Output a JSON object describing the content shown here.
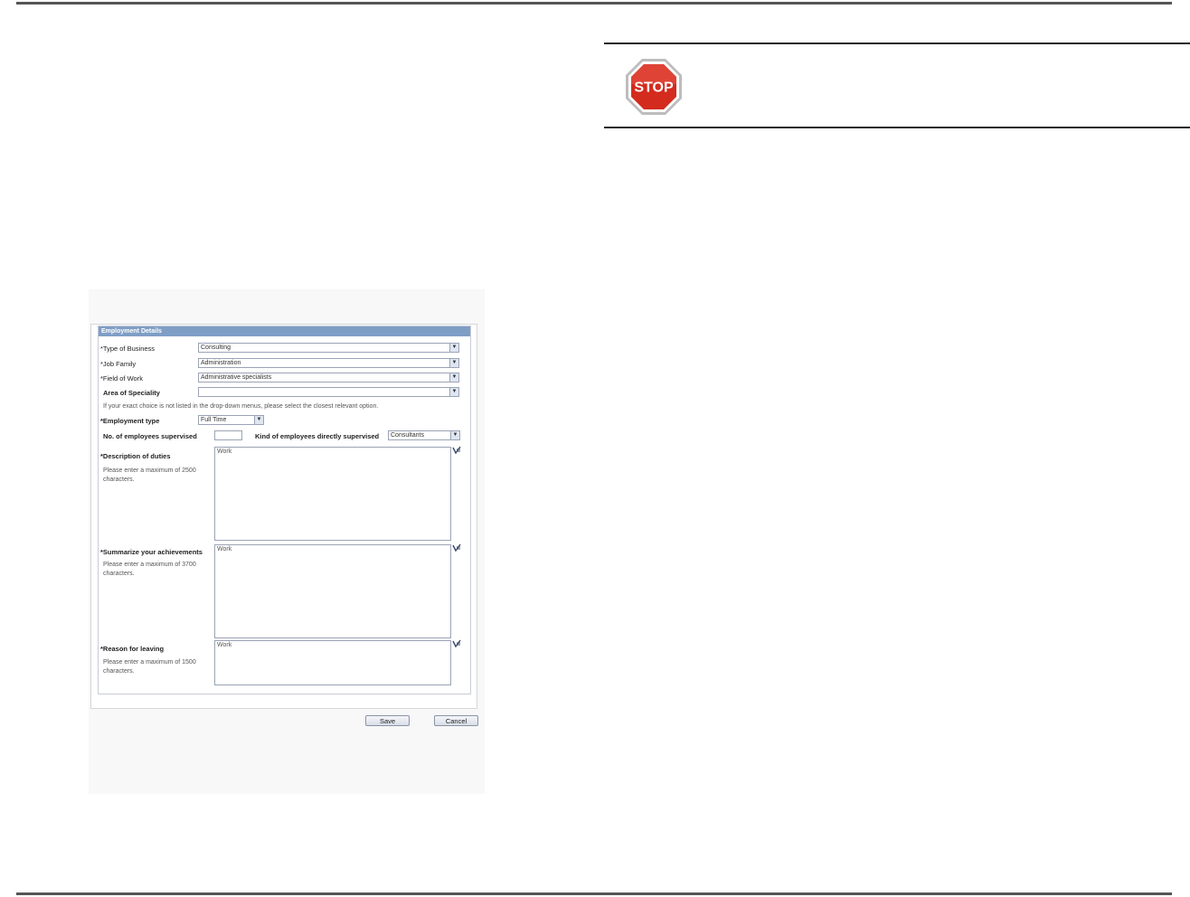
{
  "stop_sign": {
    "text": "STOP",
    "icon": "stop-sign-icon"
  },
  "form": {
    "section_title": "Employment Details",
    "type_of_business": {
      "label": "*Type of Business",
      "value": "Consulting"
    },
    "job_family": {
      "label": "*Job Family",
      "value": "Administration"
    },
    "field_of_work": {
      "label": "*Field of Work",
      "value": "Administrative specialists"
    },
    "area_of_speciality": {
      "label": "Area of Speciality",
      "value": ""
    },
    "note": "If your exact choice is not listed in the drop-down menus, please select the closest relevant option.",
    "employment_type": {
      "label": "*Employment type",
      "value": "Full Time"
    },
    "employees_supervised": {
      "label": "No. of employees supervised",
      "value": ""
    },
    "kind_supervised": {
      "label": "Kind of employees directly supervised",
      "value": "Consultants"
    },
    "description": {
      "label": "*Description of duties",
      "hint": "Please enter a maximum of 2500 characters.",
      "value": "Work"
    },
    "achievements": {
      "label": "*Summarize your achievements",
      "hint": "Please enter a maximum of 3700 characters.",
      "value": "Work"
    },
    "reason": {
      "label": "*Reason for leaving",
      "hint": "Please enter a maximum of 1500 characters.",
      "value": "Work"
    }
  },
  "buttons": {
    "save": "Save",
    "cancel": "Cancel"
  },
  "colors": {
    "header": "#7f9ec6",
    "stop_red": "#d32b1e"
  }
}
